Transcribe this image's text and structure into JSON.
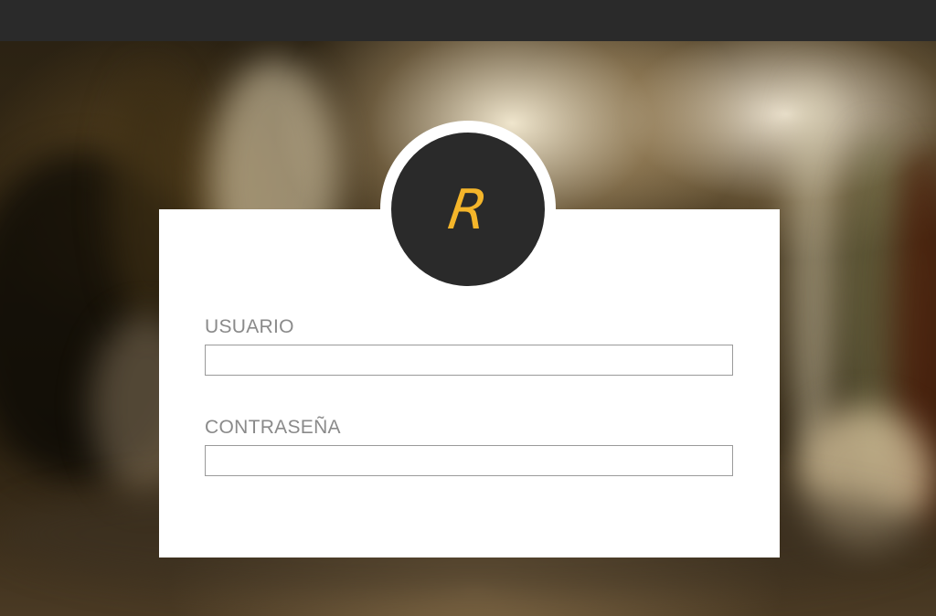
{
  "logo": {
    "letter": "R",
    "color": "#f4b52a",
    "background": "#2a2a2a"
  },
  "form": {
    "username": {
      "label": "USUARIO",
      "value": "",
      "placeholder": ""
    },
    "password": {
      "label": "CONTRASEÑA",
      "value": "",
      "placeholder": ""
    }
  },
  "colors": {
    "top_bar": "#2a2a2a",
    "card": "#ffffff",
    "label_text": "#8a8a8a",
    "input_border": "#9a9a9a"
  }
}
